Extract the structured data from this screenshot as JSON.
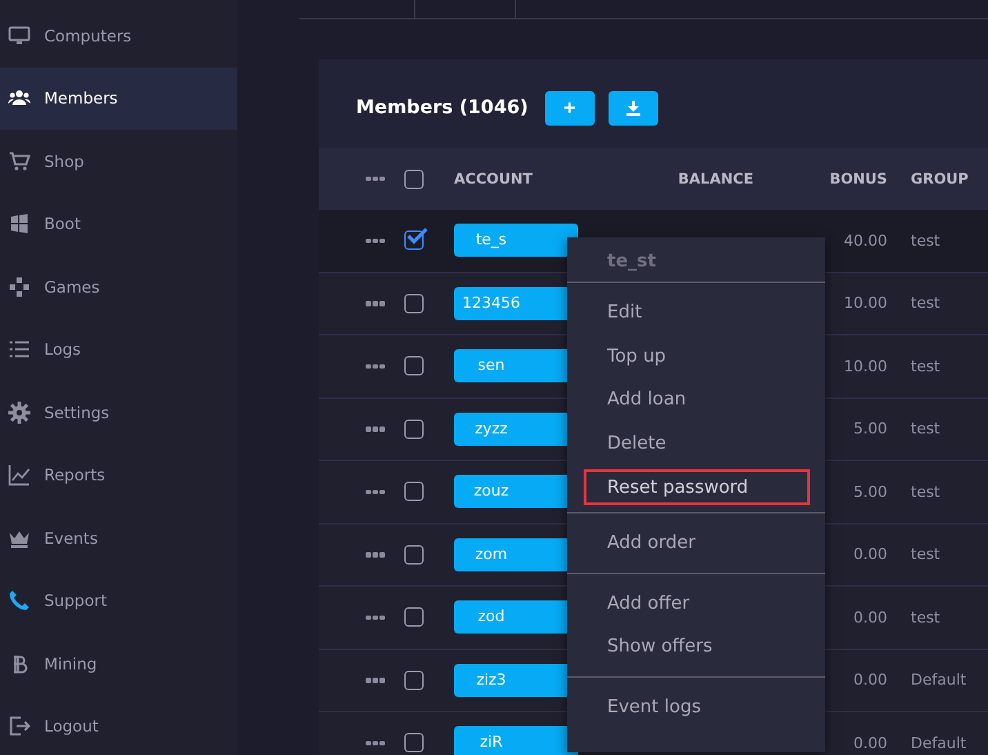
{
  "sidebar": {
    "items": [
      {
        "label": "Computers",
        "selected": false
      },
      {
        "label": "Members",
        "selected": true
      },
      {
        "label": "Shop",
        "selected": false
      },
      {
        "label": "Boot",
        "selected": false
      },
      {
        "label": "Games",
        "selected": false
      },
      {
        "label": "Logs",
        "selected": false
      },
      {
        "label": "Settings",
        "selected": false
      },
      {
        "label": "Reports",
        "selected": false
      },
      {
        "label": "Events",
        "selected": false
      },
      {
        "label": "Support",
        "selected": false
      },
      {
        "label": "Mining",
        "selected": false
      },
      {
        "label": "Logout",
        "selected": false
      }
    ]
  },
  "panel": {
    "title": "Members (1046)",
    "add_button": "+",
    "table": {
      "select_all_checked": false,
      "columns": [
        "ACCOUNT",
        "BALANCE",
        "BONUS",
        "GROUP"
      ],
      "rows": [
        {
          "account": "te_s",
          "bonus": "40.00",
          "group": "test",
          "checked": true
        },
        {
          "account": "123456",
          "bonus": "10.00",
          "group": "test",
          "checked": false
        },
        {
          "account": "sen",
          "bonus": "10.00",
          "group": "test",
          "checked": false
        },
        {
          "account": "zyzz",
          "bonus": "5.00",
          "group": "test",
          "checked": false
        },
        {
          "account": "zouz",
          "bonus": "5.00",
          "group": "test",
          "checked": false
        },
        {
          "account": "zom",
          "bonus": "0.00",
          "group": "test",
          "checked": false
        },
        {
          "account": "zod",
          "bonus": "0.00",
          "group": "test",
          "checked": false
        },
        {
          "account": "ziz3",
          "bonus": "0.00",
          "group": "Default",
          "checked": false
        },
        {
          "account": "ziR",
          "bonus": "0.00",
          "group": "Default",
          "checked": false
        }
      ]
    }
  },
  "context_menu": {
    "title": "te_st",
    "groups": [
      [
        {
          "label": "Edit",
          "outlined": false
        },
        {
          "label": "Top up",
          "outlined": false
        },
        {
          "label": "Add loan",
          "outlined": false
        },
        {
          "label": "Delete",
          "outlined": false
        },
        {
          "label": "Reset password",
          "outlined": true
        }
      ],
      [
        {
          "label": "Add order",
          "outlined": false
        }
      ],
      [
        {
          "label": "Add offer",
          "outlined": false
        },
        {
          "label": "Show offers",
          "outlined": false
        }
      ],
      [
        {
          "label": "Event logs",
          "outlined": false
        }
      ]
    ]
  }
}
